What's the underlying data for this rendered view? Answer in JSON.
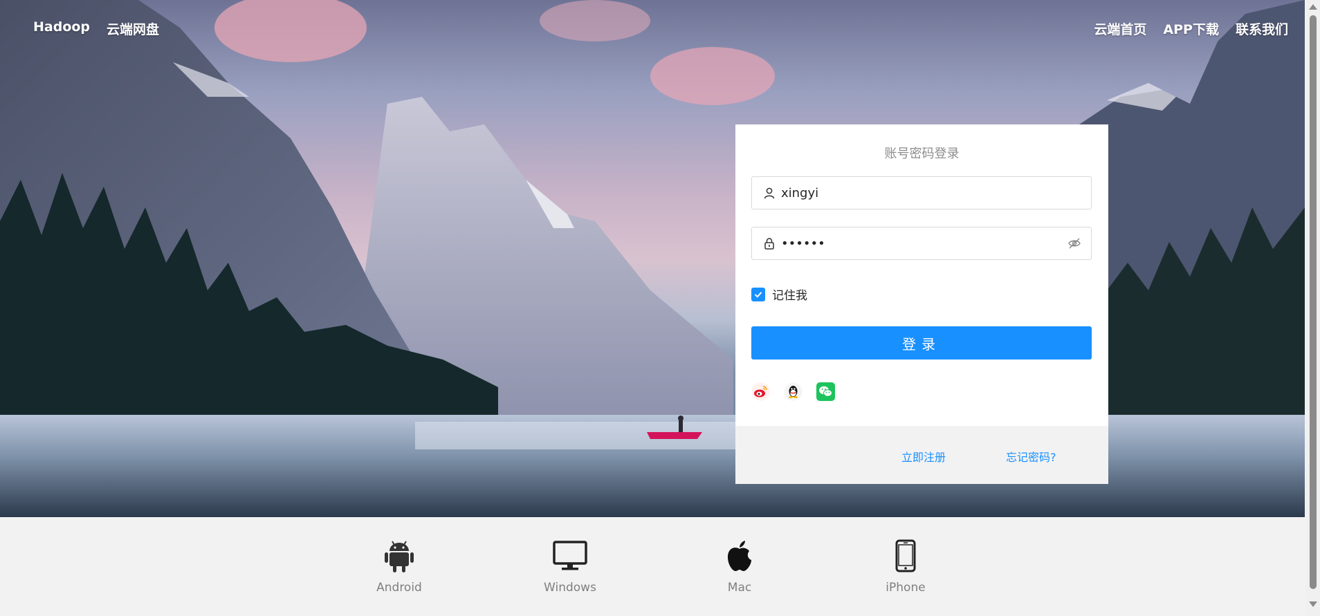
{
  "nav": {
    "brand": "Hadoop",
    "product": "云端网盘",
    "links": [
      "云端首页",
      "APP下载",
      "联系我们"
    ]
  },
  "login": {
    "title": "账号密码登录",
    "username_value": "xingyi",
    "password_value": "••••••",
    "remember_label": "记住我",
    "remember_checked": true,
    "submit_label": "登录",
    "social": [
      "weibo-icon",
      "qq-icon",
      "wechat-icon"
    ],
    "register_label": "立即注册",
    "forgot_label": "忘记密码?"
  },
  "downloads": [
    {
      "label": "Android",
      "icon": "android-icon"
    },
    {
      "label": "Windows",
      "icon": "windows-monitor-icon"
    },
    {
      "label": "Mac",
      "icon": "apple-icon"
    },
    {
      "label": "iPhone",
      "icon": "iphone-icon"
    }
  ],
  "colors": {
    "primary": "#1890ff",
    "footer_bg": "#f2f2f2"
  }
}
